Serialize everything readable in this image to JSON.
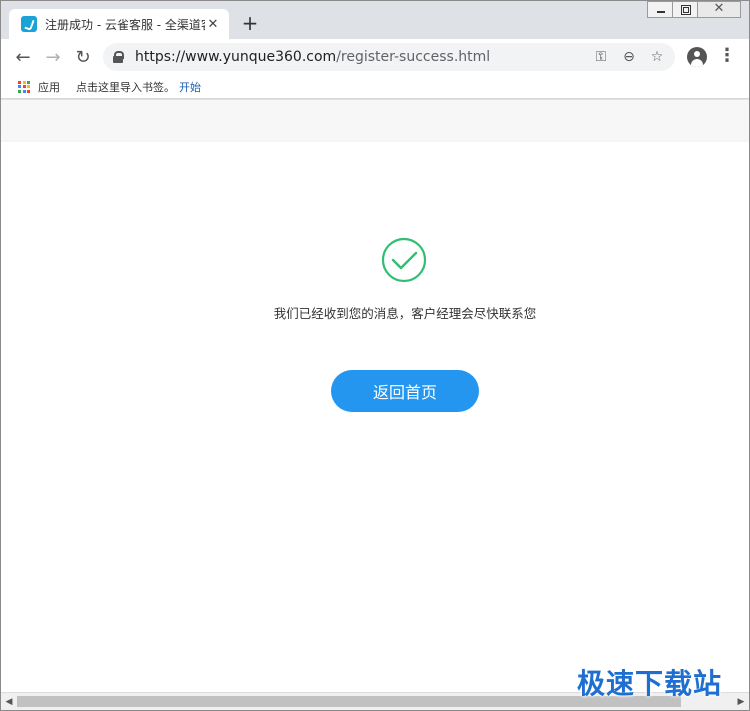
{
  "browser": {
    "tab": {
      "title": "注册成功 - 云雀客服 - 全渠道客服",
      "close_glyph": "✕"
    },
    "new_tab_glyph": "+",
    "window_controls": {
      "close_glyph": "✕"
    },
    "nav": {
      "back": "←",
      "forward": "→",
      "reload": "↻"
    },
    "url": {
      "host": "https://www.yunque360.com",
      "path": "/register-success.html"
    },
    "omni_icons": {
      "key": "⚿",
      "zoom": "⊖",
      "star": "☆"
    },
    "menu_glyph": "⋮",
    "bookmarks": {
      "apps_label": "应用",
      "import_text": "点击这里导入书签。",
      "start_link": "开始",
      "apps_colors": [
        "#ea4335",
        "#fbbc05",
        "#34a853",
        "#4285f4",
        "#ea4335",
        "#fbbc05",
        "#34a853",
        "#4285f4",
        "#ea4335"
      ]
    }
  },
  "page": {
    "message": "我们已经收到您的消息，客户经理会尽快联系您",
    "home_button_label": "返回首页",
    "accent_color": "#2496f0",
    "success_color": "#2fbf71"
  },
  "scrollbar": {
    "left_arrow": "◀",
    "right_arrow": "▶"
  },
  "watermark": "极速下载站"
}
